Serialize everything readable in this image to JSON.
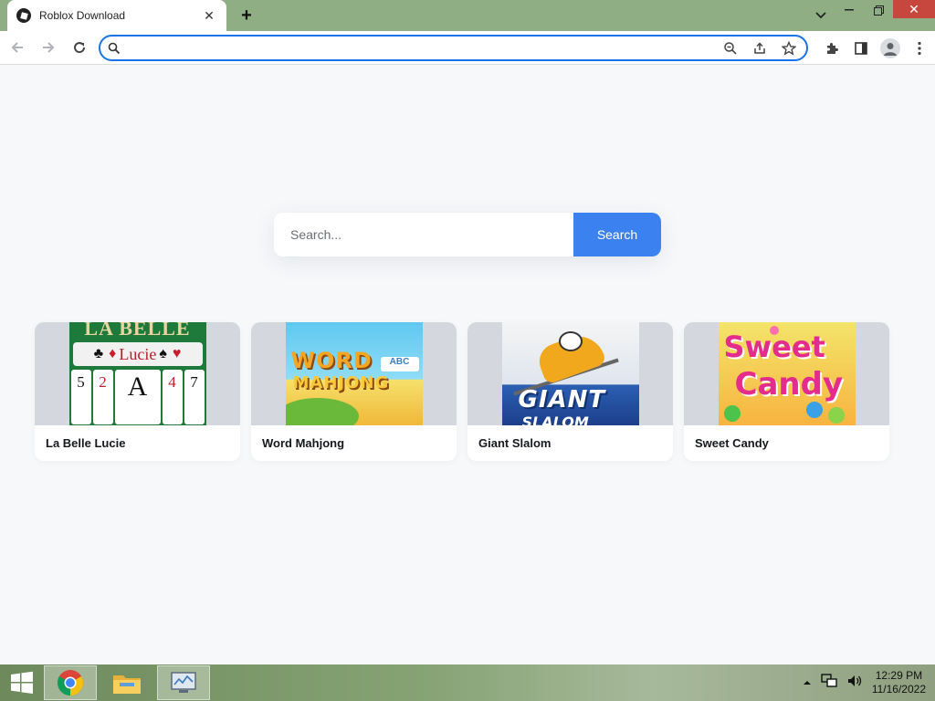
{
  "browser": {
    "tab": {
      "title": "Roblox Download",
      "favicon": "roblox-icon"
    },
    "window_controls": [
      "chevron-down-icon",
      "minimize-icon",
      "restore-icon",
      "close-icon"
    ],
    "address": {
      "value": ""
    }
  },
  "page": {
    "search": {
      "placeholder": "Search...",
      "button_label": "Search"
    },
    "games": [
      {
        "title": "La Belle Lucie",
        "thumb": {
          "banner": "LA BELLE",
          "ribbon": "Lucie"
        }
      },
      {
        "title": "Word Mahjong",
        "thumb": {
          "line1": "WORD",
          "line2": "MAHJONG",
          "badge": "ABC"
        }
      },
      {
        "title": "Giant Slalom",
        "thumb": {
          "line1": "GIANT",
          "line2": "SLALOM"
        }
      },
      {
        "title": "Sweet Candy",
        "thumb": {
          "line1": "Sweet",
          "line2": "Candy"
        }
      }
    ],
    "accent_color": "#3b82f0"
  },
  "taskbar": {
    "time": "12:29 PM",
    "date": "11/16/2022"
  }
}
